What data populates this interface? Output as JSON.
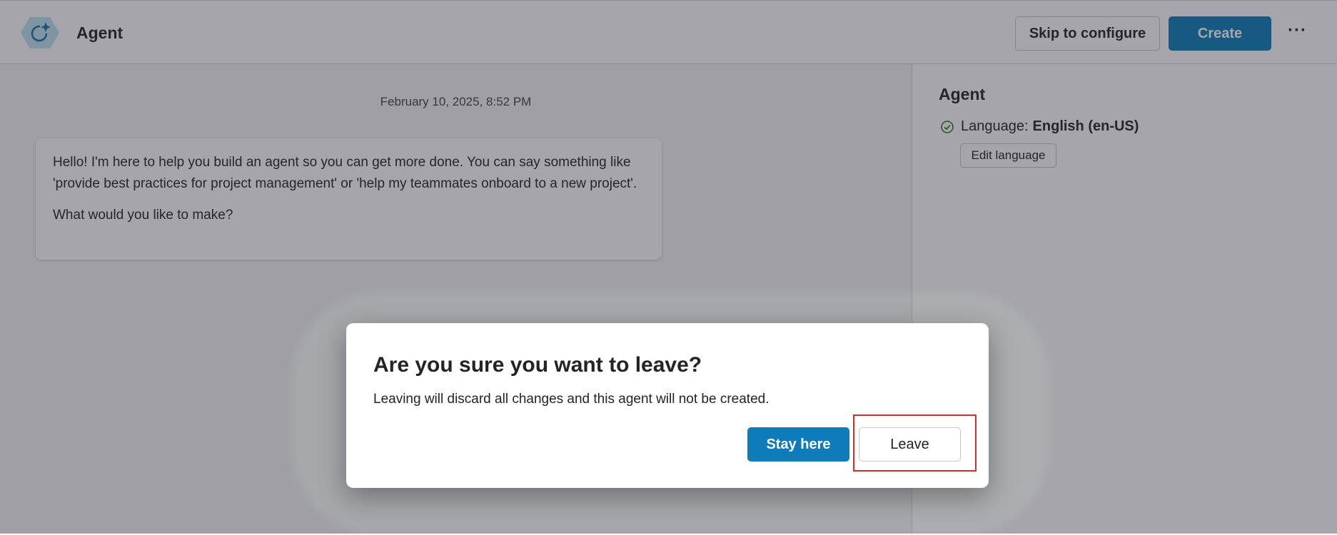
{
  "header": {
    "title": "Agent",
    "logo_icon": "agent-logo-icon",
    "skip_label": "Skip to configure",
    "create_label": "Create",
    "more_label": "···"
  },
  "chat": {
    "timestamp": "February 10, 2025, 8:52 PM",
    "message_line1": "Hello! I'm here to help you build an agent so you can get more done. You can say something like 'provide best practices for project management' or 'help my teammates onboard to a new project'.",
    "message_line2": "What would you like to make?"
  },
  "side_panel": {
    "title": "Agent",
    "language_label": "Language:",
    "language_value": "English (en-US)",
    "edit_label": "Edit language"
  },
  "dialog": {
    "title": "Are you sure you want to leave?",
    "body": "Leaving will discard all changes and this agent will not be created.",
    "stay_label": "Stay here",
    "leave_label": "Leave"
  },
  "colors": {
    "primary": "#0d7cb8",
    "highlight": "#d32f2f",
    "check": "#107c10"
  }
}
